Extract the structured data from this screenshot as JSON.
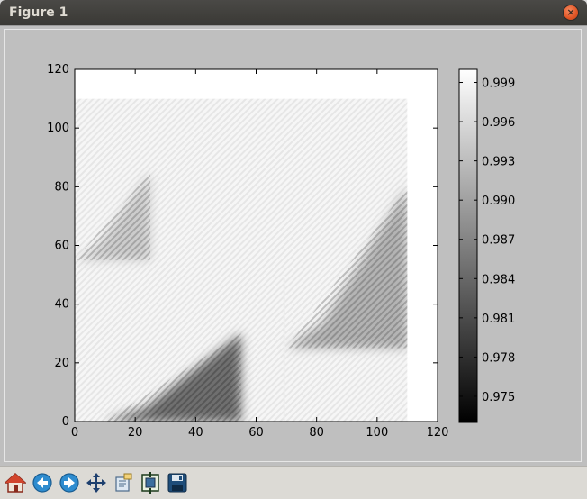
{
  "window": {
    "title": "Figure 1"
  },
  "colors": {
    "titlebar": "#3c3b37",
    "close": "#e05424",
    "canvas_bg": "#bfbfbf",
    "toolbar_bg": "#dcdad5"
  },
  "toolbar": {
    "buttons": [
      {
        "name": "home-button",
        "icon": "home-icon"
      },
      {
        "name": "back-button",
        "icon": "arrow-left-icon"
      },
      {
        "name": "forward-button",
        "icon": "arrow-right-icon"
      },
      {
        "name": "pan-button",
        "icon": "move-icon"
      },
      {
        "name": "zoom-button",
        "icon": "zoom-rect-icon"
      },
      {
        "name": "configure-subplots-button",
        "icon": "subplots-icon"
      },
      {
        "name": "save-button",
        "icon": "floppy-disk-icon"
      }
    ]
  },
  "chart_data": {
    "type": "heatmap",
    "cmap": "gray",
    "xlim": [
      0,
      120
    ],
    "ylim": [
      0,
      120
    ],
    "x_ticks": [
      "0",
      "20",
      "40",
      "60",
      "80",
      "100",
      "120"
    ],
    "y_ticks": [
      "0",
      "20",
      "40",
      "60",
      "80",
      "100",
      "120"
    ],
    "data_extent": [
      0,
      110,
      0,
      110
    ],
    "colorbar": {
      "vmin": 0.973,
      "vmax": 1.0,
      "ticks": [
        "0.975",
        "0.978",
        "0.981",
        "0.984",
        "0.987",
        "0.990",
        "0.993",
        "0.996",
        "0.999"
      ]
    },
    "dark_regions": [
      {
        "x": [
          10,
          55
        ],
        "y": [
          0,
          30
        ],
        "min_value": 0.974
      },
      {
        "x": [
          70,
          110
        ],
        "y": [
          25,
          80
        ],
        "min_value": 0.986
      },
      {
        "x": [
          0,
          25
        ],
        "y": [
          55,
          85
        ],
        "min_value": 0.991
      }
    ]
  }
}
